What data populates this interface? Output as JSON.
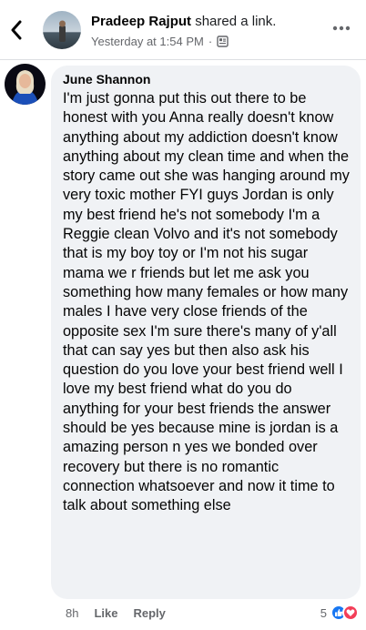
{
  "header": {
    "poster_name": "Pradeep Rajput",
    "poster_action": "shared a link.",
    "timestamp": "Yesterday at 1:54 PM",
    "separator": "·",
    "privacy_icon": "news-feed-icon"
  },
  "comment": {
    "author": "June Shannon",
    "text": "I'm just gonna put this out there to be honest with you Anna really doesn't know anything about my addiction doesn't know anything about my clean time and when the story came out she was hanging around my very toxic mother FYI guys Jordan is only my best friend he's not somebody I'm a Reggie clean Volvo and it's not somebody that is my boy toy or I'm not his sugar mama we r friends but let me ask you something how many females or how many males I have very close friends of the opposite sex I'm sure there's many of y'all that can say yes but then also ask his question do you love your best friend well I love my best friend what do you do anything for your best friends the answer should be yes because mine is jordan is a amazing person n yes we bonded over recovery but there is no romantic connection whatsoever and now it time to talk about something else",
    "age": "8h",
    "like_label": "Like",
    "reply_label": "Reply",
    "reaction_count": "5",
    "reactions": [
      "like-icon",
      "love-icon"
    ]
  },
  "colors": {
    "bubble": "#f0f2f5",
    "meta_text": "#65676b",
    "like_blue": "#1877f2",
    "love_red": "#f33e58"
  }
}
